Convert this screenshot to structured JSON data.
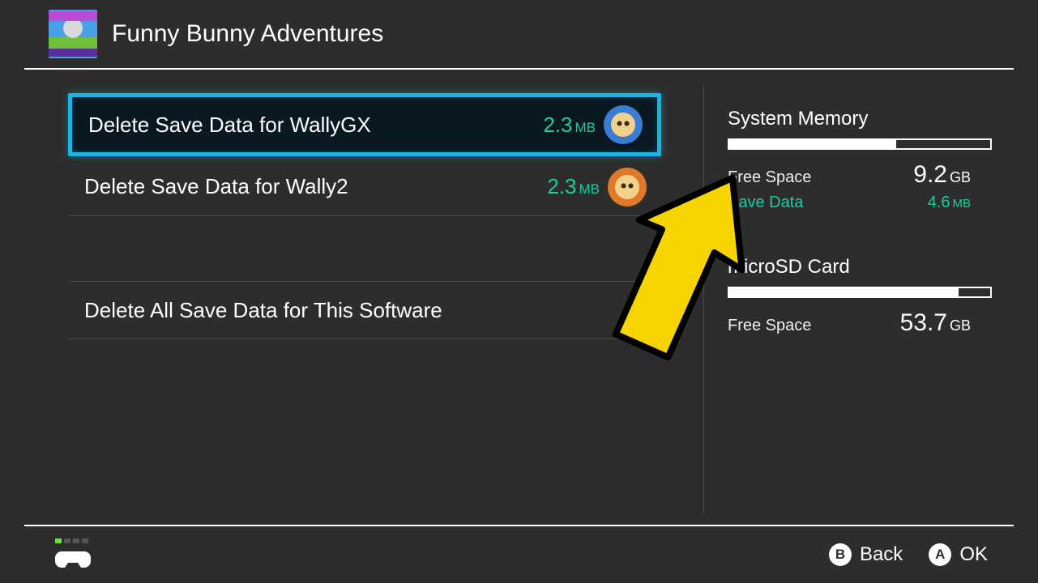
{
  "header": {
    "title": "Funny Bunny Adventures"
  },
  "rows": [
    {
      "label": "Delete Save Data for WallyGX",
      "size_value": "2.3",
      "size_unit": "MB",
      "selected": true
    },
    {
      "label": "Delete Save Data for Wally2",
      "size_value": "2.3",
      "size_unit": "MB",
      "selected": false
    }
  ],
  "delete_all_label": "Delete All Save Data for This Software",
  "storage": {
    "system": {
      "title": "System Memory",
      "fill_percent": 64,
      "free_label": "Free Space",
      "free_value": "9.2",
      "free_unit": "GB",
      "save_label": "Save Data",
      "save_value": "4.6",
      "save_unit": "MB"
    },
    "sd": {
      "title": "microSD Card",
      "fill_percent": 88,
      "free_label": "Free Space",
      "free_value": "53.7",
      "free_unit": "GB"
    }
  },
  "footer": {
    "back_glyph": "B",
    "back_label": "Back",
    "ok_glyph": "A",
    "ok_label": "OK"
  }
}
